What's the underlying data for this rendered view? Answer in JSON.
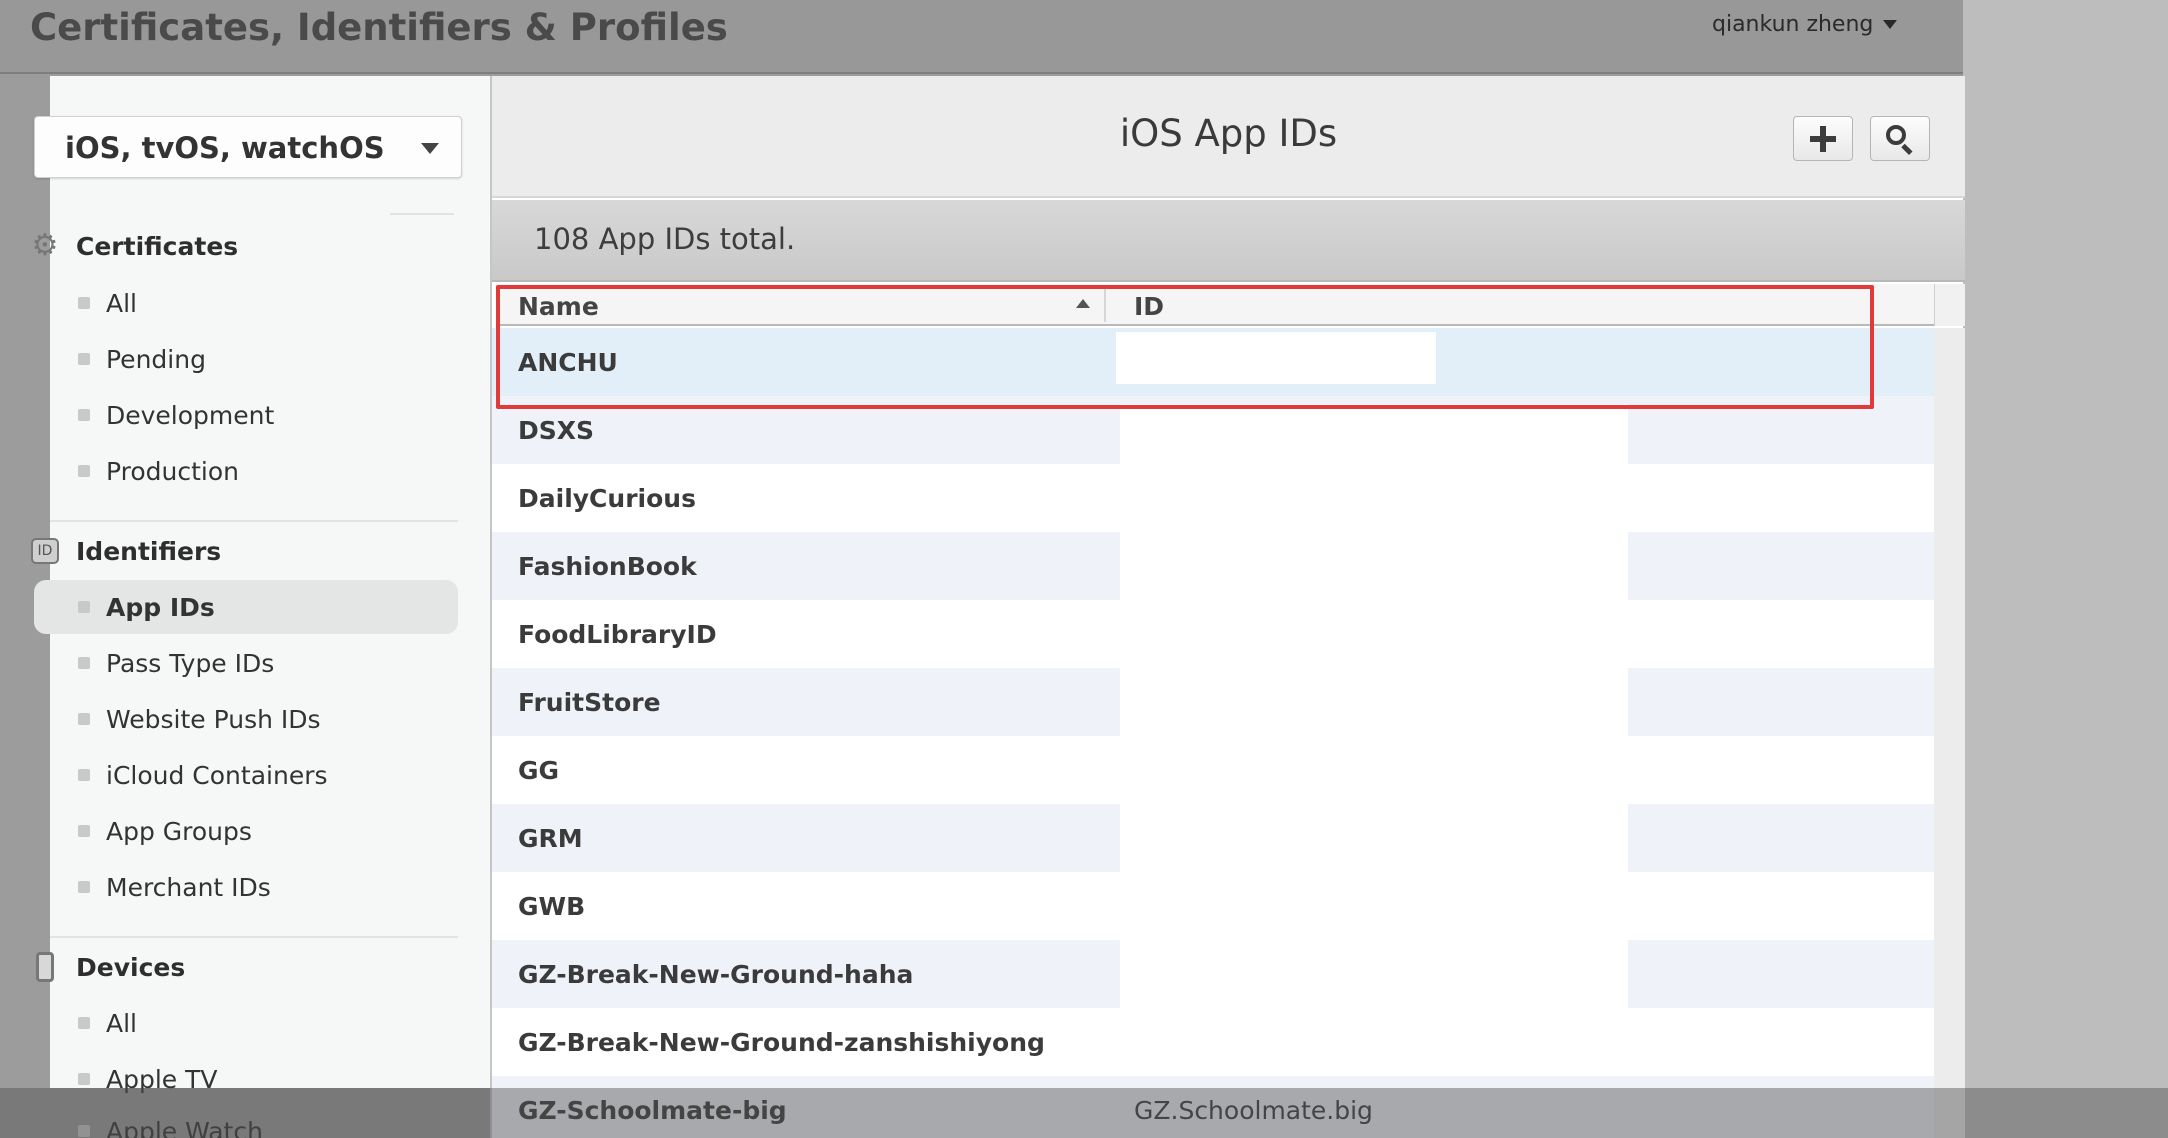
{
  "header": {
    "title": "Certificates, Identifiers & Profiles",
    "user": "qiankun zheng"
  },
  "sidebar": {
    "platform": "iOS, tvOS, watchOS",
    "sections": {
      "certificates": {
        "label": "Certificates",
        "items": [
          "All",
          "Pending",
          "Development",
          "Production"
        ]
      },
      "identifiers": {
        "label": "Identifiers",
        "icon_text": "ID",
        "items": [
          "App IDs",
          "Pass Type IDs",
          "Website Push IDs",
          "iCloud Containers",
          "App Groups",
          "Merchant IDs"
        ]
      },
      "devices": {
        "label": "Devices",
        "items": [
          "All",
          "Apple TV",
          "Apple Watch"
        ]
      }
    },
    "active_item": "App IDs"
  },
  "main": {
    "title": "iOS App IDs",
    "count_text": "108  App IDs total.",
    "columns": {
      "name": "Name",
      "id": "ID"
    },
    "rows": [
      {
        "name": "ANCHU",
        "id": ""
      },
      {
        "name": "DSXS",
        "id": ""
      },
      {
        "name": "DailyCurious",
        "id": ""
      },
      {
        "name": "FashionBook",
        "id": ""
      },
      {
        "name": "FoodLibraryID",
        "id": ""
      },
      {
        "name": "FruitStore",
        "id": ""
      },
      {
        "name": "GG",
        "id": ""
      },
      {
        "name": "GRM",
        "id": ""
      },
      {
        "name": "GWB",
        "id": ""
      },
      {
        "name": "GZ-Break-New-Ground-haha",
        "id": ""
      },
      {
        "name": "GZ-Break-New-Ground-zanshishiyong",
        "id": ""
      },
      {
        "name": "GZ-Schoolmate-big",
        "id": "GZ.Schoolmate.big"
      }
    ]
  },
  "colors": {
    "highlight": "#e03a3a",
    "row_alt": "#eff3f9",
    "row_selected": "#e2eff8"
  }
}
